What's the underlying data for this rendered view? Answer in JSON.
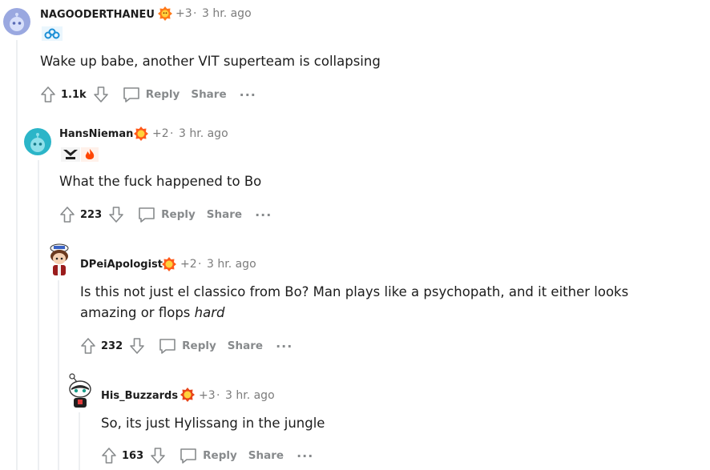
{
  "comments": [
    {
      "username": "NAGOODERTHANEU",
      "karma": "+3",
      "separator": "·",
      "time": "3 hr. ago",
      "body": "Wake up babe, another VIT superteam is collapsing",
      "score": "1.1k",
      "reply_label": "Reply",
      "share_label": "Share"
    },
    {
      "username": "HansNieman",
      "karma": "+2",
      "separator": "·",
      "time": "3 hr. ago",
      "body": "What the fuck happened to Bo",
      "score": "223",
      "reply_label": "Reply",
      "share_label": "Share"
    },
    {
      "username": "DPeiApologist",
      "karma": "+2",
      "separator": "·",
      "time": "3 hr. ago",
      "body_line1": "Is this not just el classico from Bo? Man plays like a psychopath, and it either looks",
      "body_line2": "amazing or flops ",
      "body_emphasis": "hard",
      "score": "232",
      "reply_label": "Reply",
      "share_label": "Share"
    },
    {
      "username": "His_Buzzards",
      "karma": "+3",
      "separator": "·",
      "time": "3 hr. ago",
      "body": "So, its just Hylissang in the jungle",
      "score": "163",
      "reply_label": "Reply",
      "share_label": "Share"
    }
  ],
  "icons": {
    "award": "award-icon",
    "upvote": "upvote-arrow-icon",
    "downvote": "downvote-arrow-icon",
    "reply": "speech-bubble-icon",
    "more": "more-options-icon"
  },
  "colors": {
    "text": "#1c1c1c",
    "meta": "#7c7c7c",
    "action": "#878a8c",
    "thread_line": "#edeff1",
    "award_orange": "#ff4500"
  }
}
